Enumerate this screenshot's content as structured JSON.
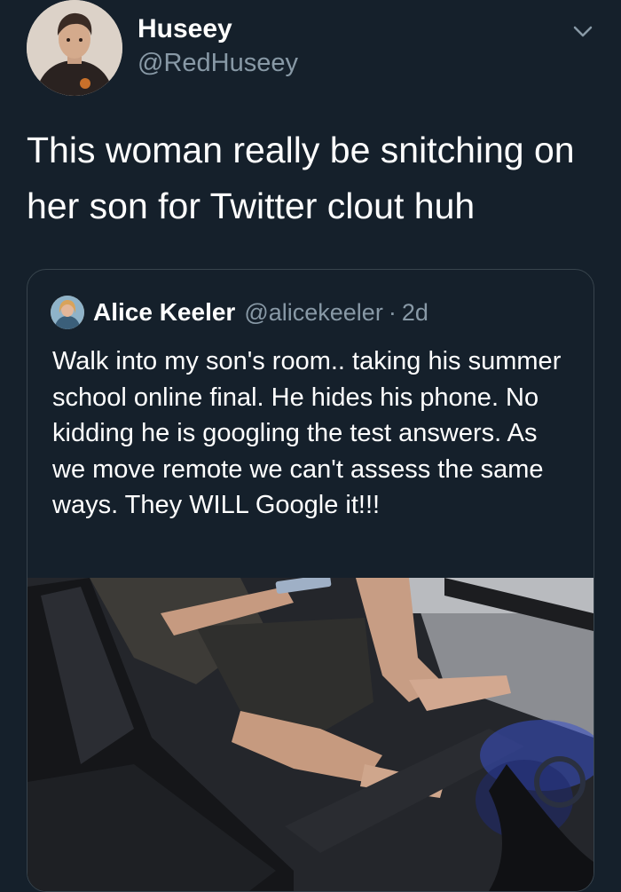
{
  "tweet": {
    "author": {
      "display_name": "Huseey",
      "handle": "@RedHuseey",
      "avatar_icon": "user-avatar"
    },
    "menu_icon": "chevron-down-icon",
    "text": "This woman really be snitching on her son for Twitter clout huh"
  },
  "quoted_tweet": {
    "author": {
      "display_name": "Alice Keeler",
      "handle": "@alicekeeler",
      "avatar_icon": "user-avatar"
    },
    "separator": "·",
    "time_ago": "2d",
    "text": "Walk into my son's room.. taking his summer school online final. He hides his phone. No kidding he is googling the test answers. As we move remote we can't assess the same ways. They WILL Google it!!!",
    "image": {
      "alt_icon": "photo-son-at-desk-with-phone"
    }
  },
  "colors": {
    "background": "#15202b",
    "text_primary": "#ffffff",
    "text_secondary": "#8899a6",
    "border": "#38444d"
  }
}
